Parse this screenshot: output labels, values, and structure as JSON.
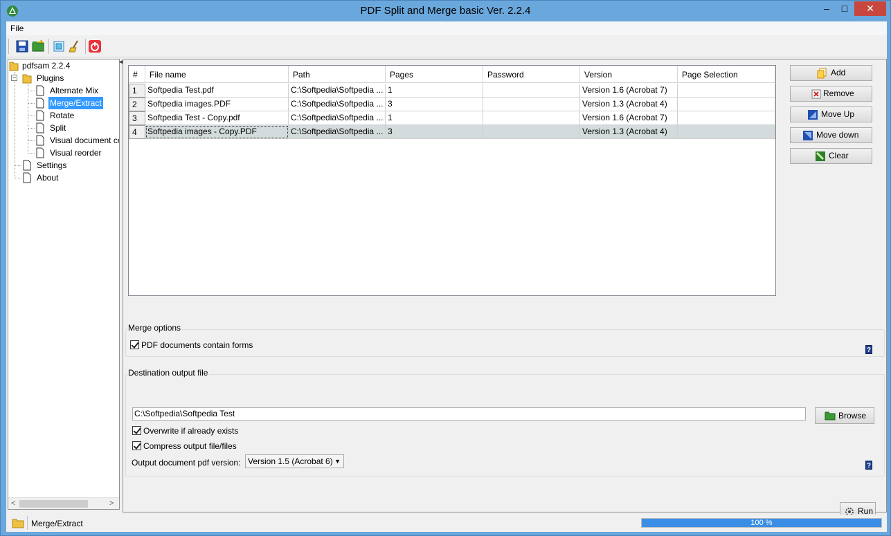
{
  "window": {
    "title": "PDF Split and Merge basic Ver. 2.2.4",
    "minimize": "–",
    "maximize": "□",
    "close": "✕"
  },
  "menu": {
    "file": "File"
  },
  "toolbar": {
    "icons": [
      "save-icon",
      "open-icon",
      "window-icon",
      "clear-icon",
      "exit-icon"
    ]
  },
  "tree": {
    "root": "pdfsam 2.2.4",
    "plugins": "Plugins",
    "plugin_items": [
      "Alternate Mix",
      "Merge/Extract",
      "Rotate",
      "Split",
      "Visual document co",
      "Visual reorder"
    ],
    "settings": "Settings",
    "about": "About",
    "selected": "Merge/Extract",
    "scroll_left": "<",
    "scroll_right": ">"
  },
  "table": {
    "columns": [
      "#",
      "File name",
      "Path",
      "Pages",
      "Password",
      "Version",
      "Page Selection"
    ],
    "rows": [
      {
        "num": "1",
        "file": "Softpedia Test.pdf",
        "path": "C:\\Softpedia\\Softpedia ...",
        "pages": "1",
        "password": "",
        "version": "Version 1.6 (Acrobat 7)",
        "selection": ""
      },
      {
        "num": "2",
        "file": "Softpedia images.PDF",
        "path": "C:\\Softpedia\\Softpedia ...",
        "pages": "3",
        "password": "",
        "version": "Version 1.3 (Acrobat 4)",
        "selection": ""
      },
      {
        "num": "3",
        "file": "Softpedia Test - Copy.pdf",
        "path": "C:\\Softpedia\\Softpedia ...",
        "pages": "1",
        "password": "",
        "version": "Version 1.6 (Acrobat 7)",
        "selection": ""
      },
      {
        "num": "4",
        "file": "Softpedia images - Copy.PDF",
        "path": "C:\\Softpedia\\Softpedia ...",
        "pages": "3",
        "password": "",
        "version": "Version 1.3 (Acrobat 4)",
        "selection": ""
      }
    ],
    "selected_row": 4
  },
  "buttons": {
    "add": "Add",
    "remove": "Remove",
    "move_up": "Move Up",
    "move_down": "Move down",
    "clear": "Clear"
  },
  "merge_options": {
    "title": "Merge options",
    "contain_forms": "PDF documents contain forms",
    "contain_forms_checked": true,
    "help": "?"
  },
  "destination": {
    "title": "Destination output file",
    "path": "C:\\Softpedia\\Softpedia Test",
    "browse": "Browse",
    "overwrite": "Overwrite if already exists",
    "overwrite_checked": true,
    "compress": "Compress output file/files",
    "compress_checked": true,
    "version_label": "Output document pdf version:",
    "version_value": "Version 1.5 (Acrobat 6)",
    "help": "?"
  },
  "run": "Run",
  "status": {
    "plugin": "Merge/Extract",
    "progress_label": "100 %",
    "progress_fraction": 1.0
  }
}
